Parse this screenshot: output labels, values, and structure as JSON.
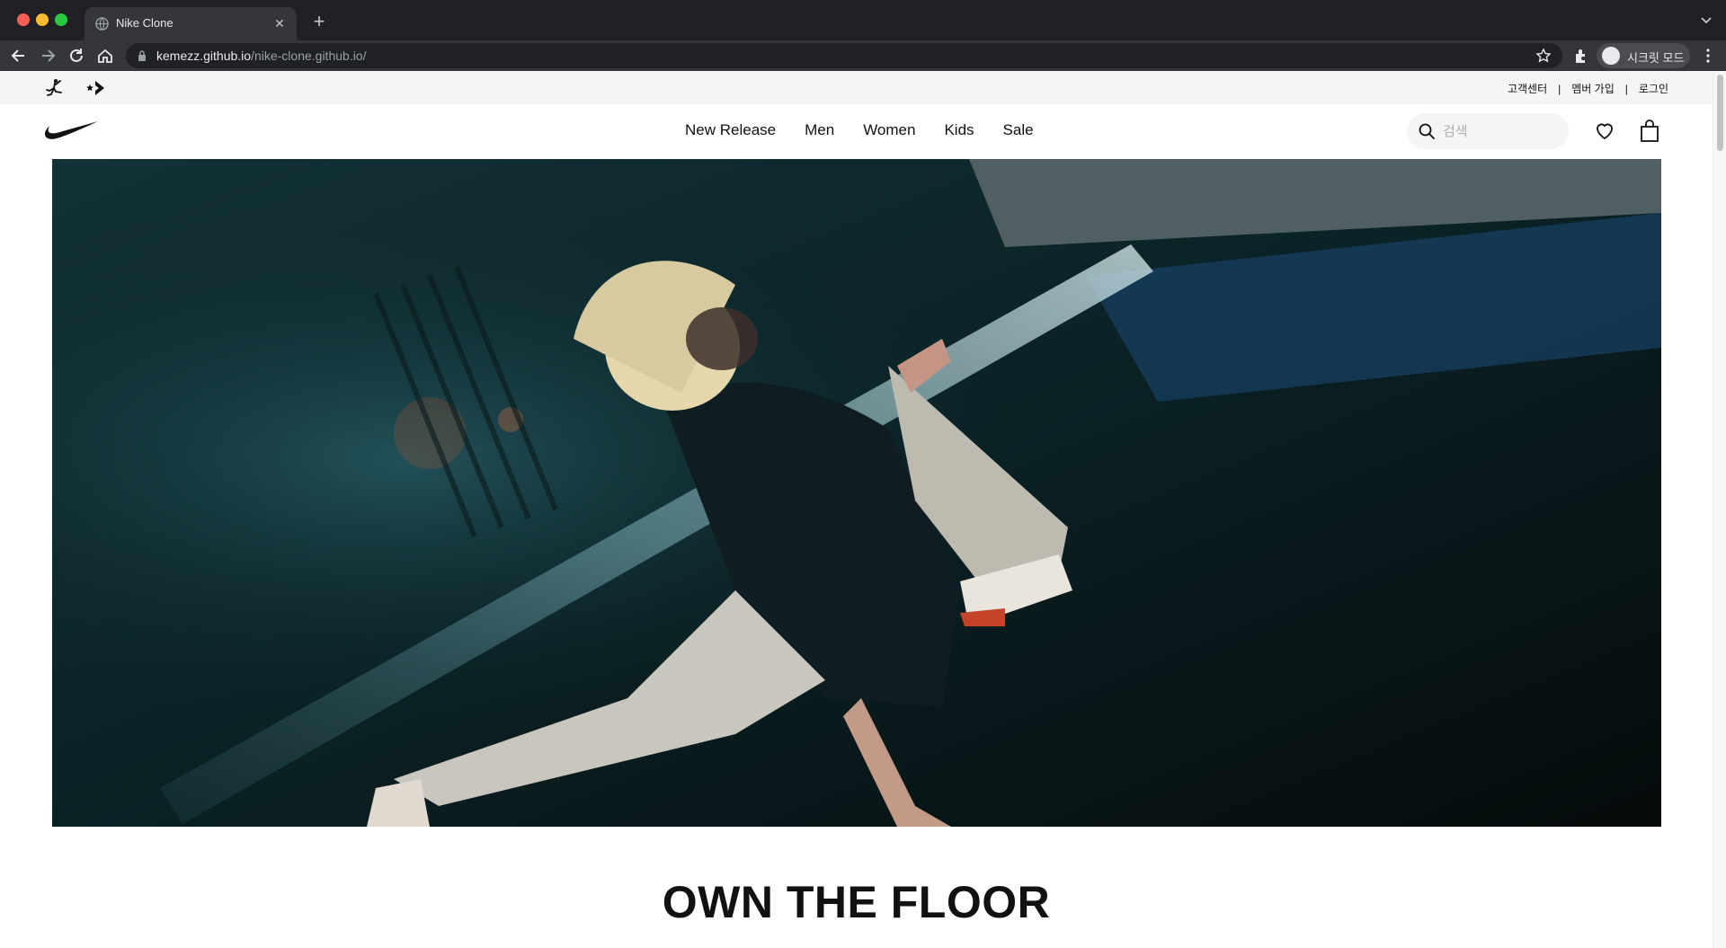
{
  "browser": {
    "tab_title": "Nike Clone",
    "url_host": "kemezz.github.io",
    "url_path": "/nike-clone.github.io/",
    "profile_label": "시크릿 모드"
  },
  "utility": {
    "brand_icons": [
      "jordan-icon",
      "converse-icon"
    ],
    "links": {
      "help": "고객센터",
      "join": "멤버 가입",
      "login": "로그인"
    },
    "separator": "|"
  },
  "nav": {
    "logo": "nike-swoosh",
    "items": [
      "New Release",
      "Men",
      "Women",
      "Kids",
      "Sale"
    ],
    "search": {
      "placeholder": "검색"
    }
  },
  "hero": {
    "headline": "OWN THE FLOOR"
  },
  "colors": {
    "chrome_dark": "#202124",
    "chrome_toolbar": "#35363a",
    "utility_bg": "#f5f5f5",
    "text": "#111111"
  }
}
